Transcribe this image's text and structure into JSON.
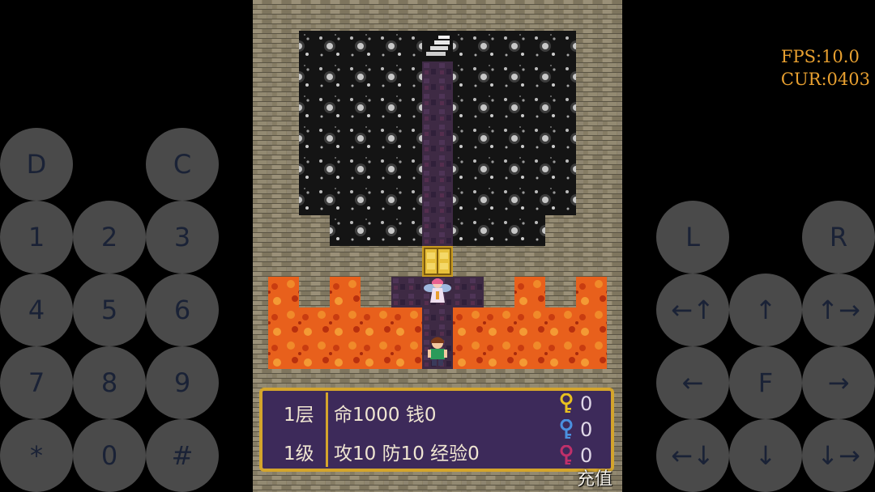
{
  "overlay": {
    "fps": "FPS:10.0",
    "cur": "CUR:0403"
  },
  "left_pad": [
    {
      "name": "d-button",
      "label": "D"
    },
    {
      "name": "c-button",
      "label": "C"
    },
    {
      "name": "num-1-button",
      "label": "1"
    },
    {
      "name": "num-2-button",
      "label": "2"
    },
    {
      "name": "num-3-button",
      "label": "3"
    },
    {
      "name": "num-4-button",
      "label": "4"
    },
    {
      "name": "num-5-button",
      "label": "5"
    },
    {
      "name": "num-6-button",
      "label": "6"
    },
    {
      "name": "num-7-button",
      "label": "7"
    },
    {
      "name": "num-8-button",
      "label": "8"
    },
    {
      "name": "num-9-button",
      "label": "9"
    },
    {
      "name": "star-button",
      "label": "*"
    },
    {
      "name": "num-0-button",
      "label": "0"
    },
    {
      "name": "hash-button",
      "label": "#"
    }
  ],
  "right_pad": [
    {
      "name": "l-button",
      "label": "L"
    },
    {
      "name": "r-button",
      "label": "R"
    },
    {
      "name": "up-left-button",
      "label": "←↑"
    },
    {
      "name": "up-button",
      "label": "↑"
    },
    {
      "name": "up-right-button",
      "label": "↑→"
    },
    {
      "name": "left-button",
      "label": "←"
    },
    {
      "name": "f-button",
      "label": "F"
    },
    {
      "name": "right-button",
      "label": "→"
    },
    {
      "name": "down-left-button",
      "label": "←↓"
    },
    {
      "name": "down-button",
      "label": "↓"
    },
    {
      "name": "down-right-button",
      "label": "↓→"
    }
  ],
  "hud": {
    "floor": "1层",
    "level": "1级",
    "life_money": "命1000 钱0",
    "stats": "攻10 防10 经验0",
    "keys": [
      {
        "color": "yellow",
        "count": "0",
        "hex": "#e8c020"
      },
      {
        "color": "blue",
        "count": "0",
        "hex": "#4a90e0"
      },
      {
        "color": "red",
        "count": "0",
        "hex": "#c0306a"
      }
    ],
    "charge": "充值"
  },
  "colors": {
    "brick": "#8a8066",
    "lava": "#e8601c",
    "dark": "#111111",
    "path": "#3e2a44",
    "hud_border": "#d4a52c"
  }
}
